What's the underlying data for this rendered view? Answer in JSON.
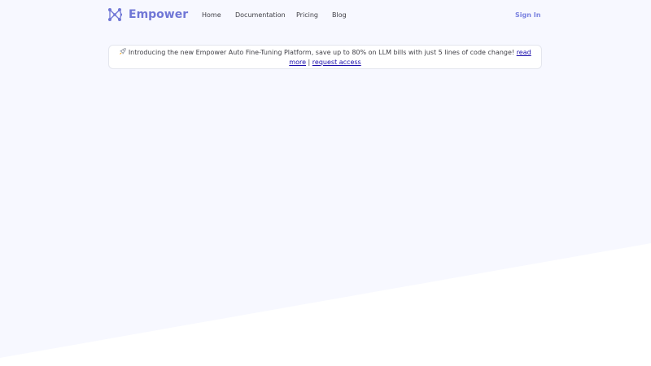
{
  "brand": {
    "name": "Empower",
    "logo_icon": "molecule-icon",
    "color": "#7077d6"
  },
  "nav": {
    "items": [
      {
        "label": "Home"
      },
      {
        "label": "Documentation"
      },
      {
        "label": "Pricing"
      },
      {
        "label": "Blog"
      }
    ],
    "signin_label": "Sign In",
    "signin_color": "#7b83e0"
  },
  "announcement": {
    "icon": "rocket-icon",
    "text": " Introducing the new Empower Auto Fine-Tuning Platform, save up to 80% on LLM bills with just 5 lines of code change! ",
    "read_more_label": "read more",
    "separator": " | ",
    "request_access_label": "request access"
  },
  "colors": {
    "background_tint": "#f7f8ff",
    "background_white": "#ffffff",
    "link": "#1a0dab"
  }
}
